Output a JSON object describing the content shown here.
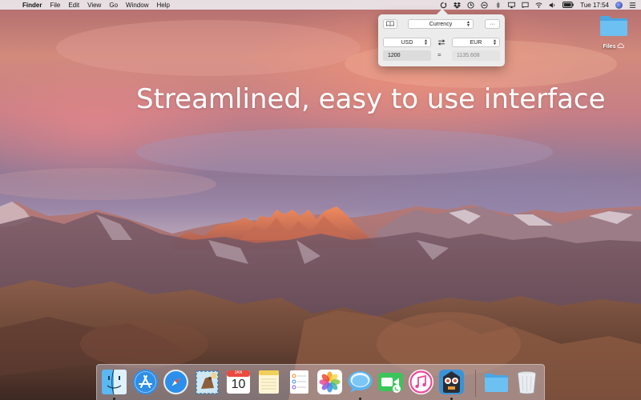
{
  "menubar": {
    "apple_glyph": "",
    "app_name": "Finder",
    "menus": [
      "File",
      "Edit",
      "View",
      "Go",
      "Window",
      "Help"
    ],
    "status_icons": [
      "sync-icon",
      "dropbox-icon",
      "clock-icon",
      "minus-circle-icon",
      "bluetooth-icon",
      "airplay-icon",
      "cast-icon",
      "wifi-icon",
      "volume-icon",
      "battery-icon"
    ],
    "clock": "Tue 17:54"
  },
  "popover": {
    "book_icon": "book-icon",
    "mode_label": "Currency",
    "more_label": "···",
    "from_currency": "USD",
    "to_currency": "EUR",
    "swap_icon": "swap-icon",
    "amount_input": "1200",
    "equals": "=",
    "result_value": "1135.608"
  },
  "headline": "Streamlined, easy to use interface",
  "desktop": {
    "folder_label": "Files",
    "folder_icon": "folder-icon",
    "cloud_icon": "icloud-download-icon"
  },
  "dock": {
    "items": [
      {
        "name": "finder-icon",
        "running": true
      },
      {
        "name": "app-store-icon",
        "running": false
      },
      {
        "name": "safari-icon",
        "running": false
      },
      {
        "name": "mail-icon",
        "running": false
      },
      {
        "name": "calendar-icon",
        "running": false,
        "month": "JAN",
        "day": "10"
      },
      {
        "name": "notes-icon",
        "running": false
      },
      {
        "name": "reminders-icon",
        "running": false
      },
      {
        "name": "photos-icon",
        "running": false
      },
      {
        "name": "messages-icon",
        "running": true
      },
      {
        "name": "facetime-icon",
        "running": false
      },
      {
        "name": "itunes-icon",
        "running": false
      },
      {
        "name": "tweetbot-icon",
        "running": true
      },
      {
        "name": "documents-folder-icon",
        "running": false
      },
      {
        "name": "trash-icon",
        "running": false
      }
    ]
  },
  "colors": {
    "menubar_bg": "#ece8ec",
    "popover_bg": "#ececec",
    "folder_blue": "#5eb6ee",
    "headline": "#ffffff"
  }
}
